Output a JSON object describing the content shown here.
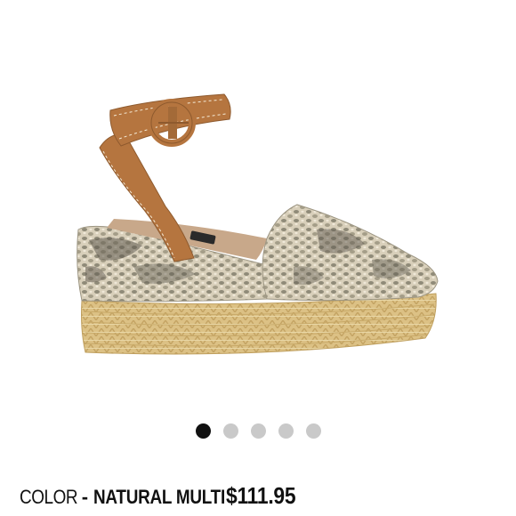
{
  "product": {
    "image_alt": "Snakeskin espadrille wedge sandal with tan ankle strap",
    "colors": {
      "strap": "#b5753f",
      "jute": "#dcc185",
      "snake_light": "#d6ccb6",
      "snake_dark": "#6b665a"
    }
  },
  "carousel": {
    "total": 5,
    "active_index": 0
  },
  "details": {
    "color_label": "COLOR",
    "separator": "-",
    "color_value": "NATURAL MULTI",
    "price": "$111.95"
  }
}
